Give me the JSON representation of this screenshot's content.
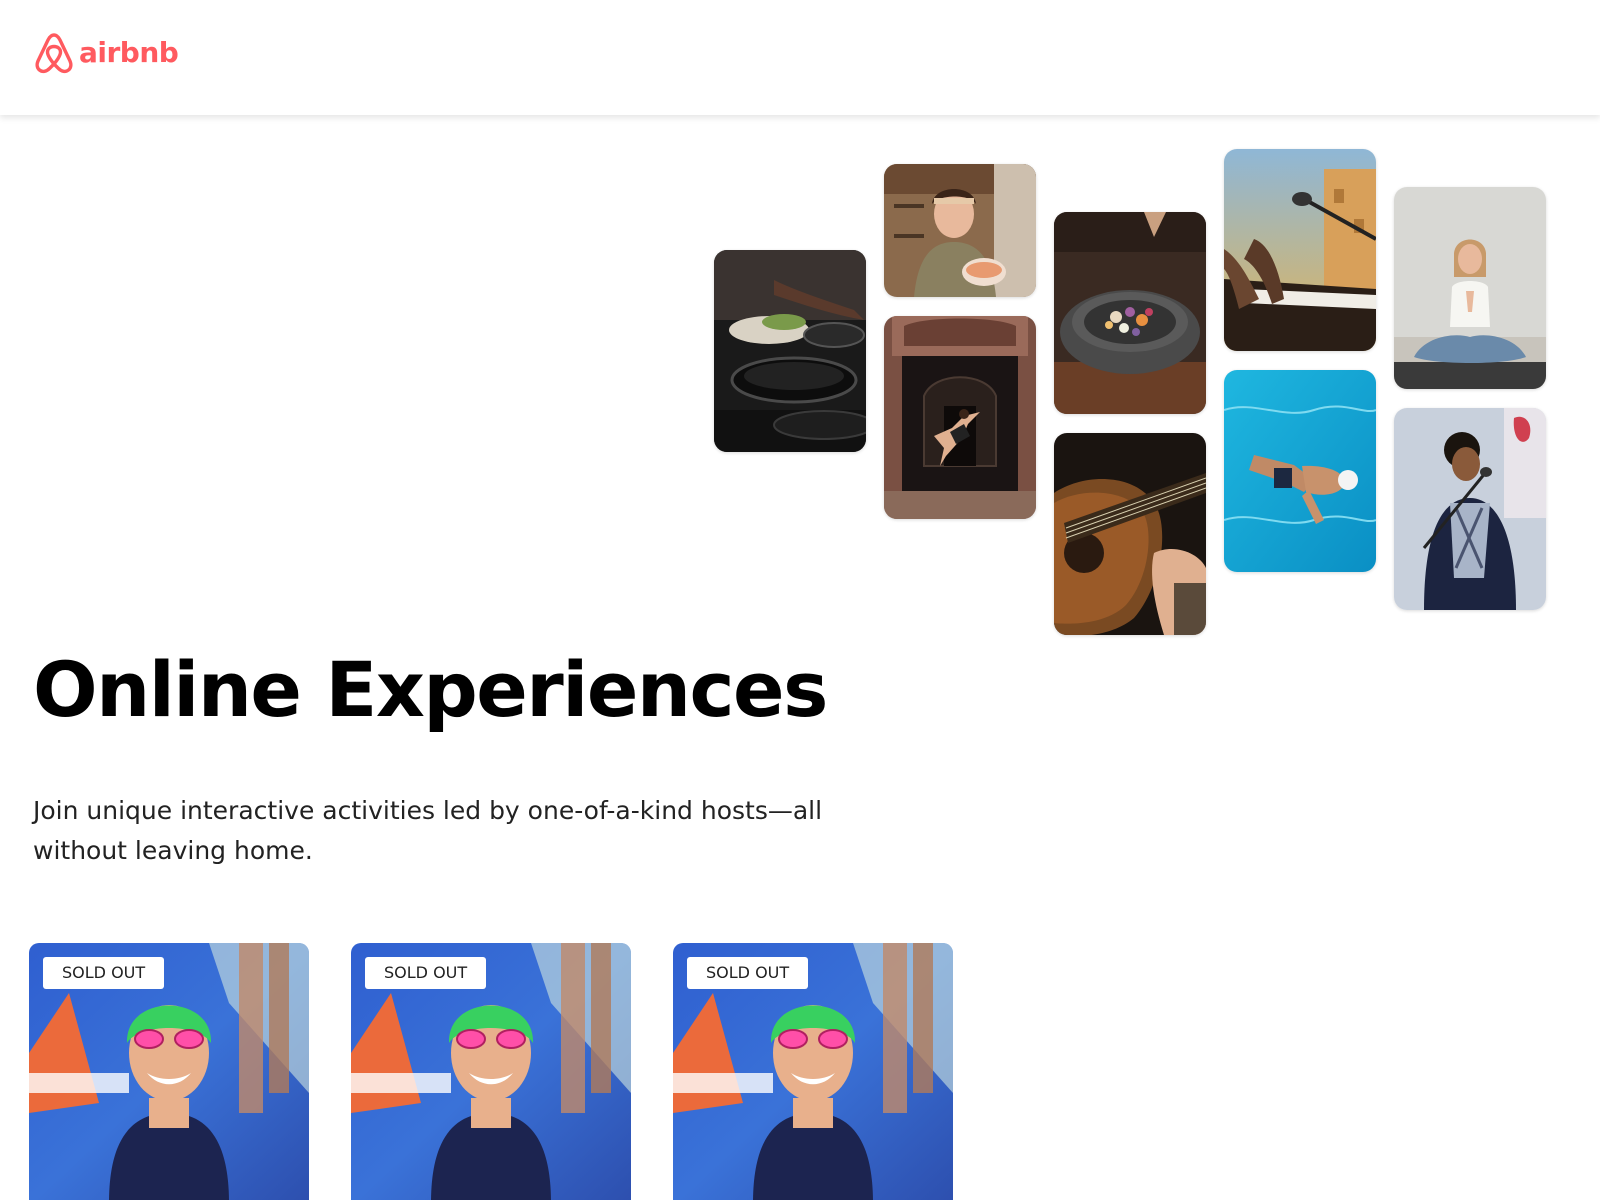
{
  "navbar": {
    "logo_text": "airbnb",
    "logo_icon": "airbnb-belo-icon",
    "brand_color": "#ff5a5f"
  },
  "photo_grid": [
    {
      "name": "cooking-pans-photo"
    },
    {
      "name": "baker-woman-photo"
    },
    {
      "name": "dancer-doorway-photo"
    },
    {
      "name": "stone-bowl-food-photo"
    },
    {
      "name": "guitar-player-photo"
    },
    {
      "name": "piano-microphone-photo"
    },
    {
      "name": "swimmer-pool-photo"
    },
    {
      "name": "yoga-woman-photo"
    },
    {
      "name": "singer-microphone-photo"
    }
  ],
  "hero": {
    "title": "Online Experiences",
    "subtitle": "Join unique interactive activities led by one-of-a-kind hosts—all without leaving home."
  },
  "cards": [
    {
      "badge": "SOLD OUT",
      "image": "swimmer-athlete-photo"
    },
    {
      "badge": "SOLD OUT",
      "image": "swimmer-athlete-photo"
    },
    {
      "badge": "SOLD OUT",
      "image": "swimmer-athlete-photo"
    }
  ]
}
